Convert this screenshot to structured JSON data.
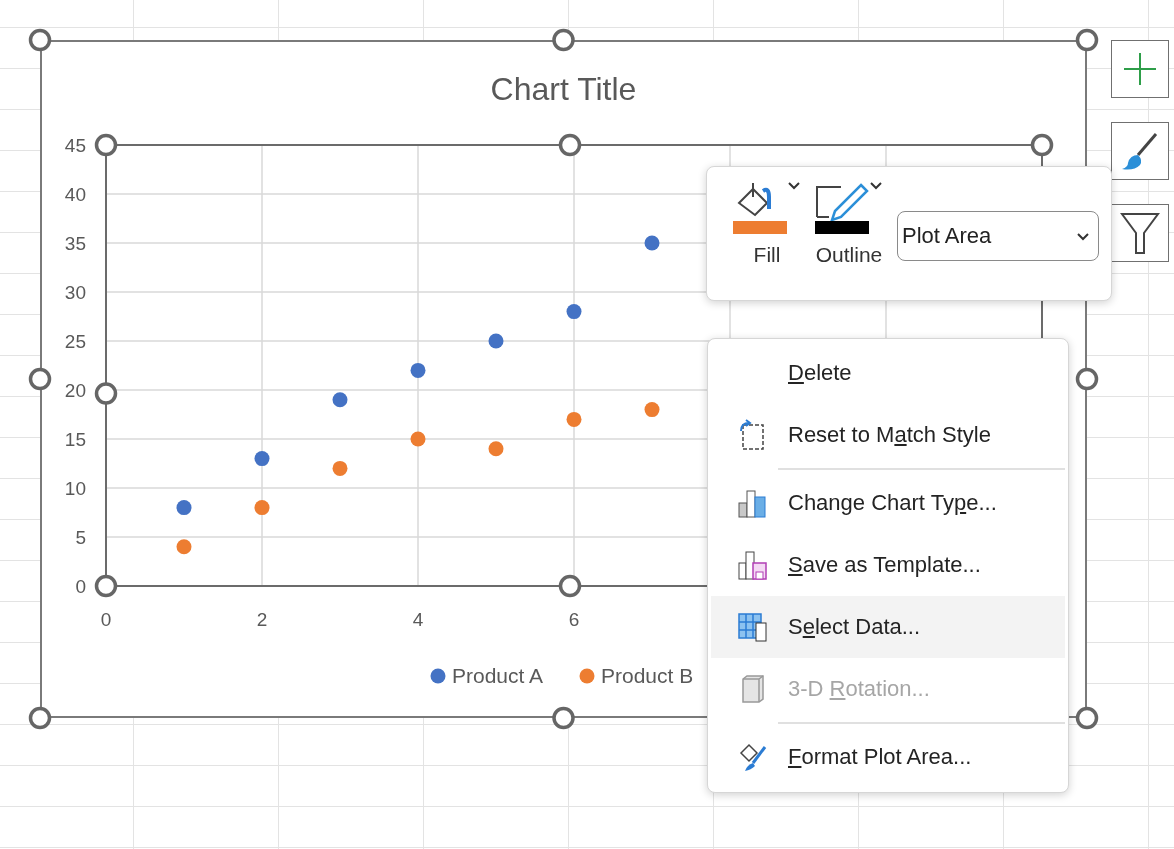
{
  "chart": {
    "selected": true,
    "plot_area_selected": true,
    "chart_data": {
      "type": "scatter",
      "title": "Chart Title",
      "grid": true,
      "legend": true,
      "x": [
        1,
        2,
        3,
        4,
        5,
        6,
        7
      ],
      "xlim": [
        0,
        12
      ],
      "ylim": [
        0,
        45
      ],
      "xticks": [
        0,
        2,
        4,
        6
      ],
      "yticks": [
        0,
        5,
        10,
        15,
        20,
        25,
        30,
        35,
        40,
        45
      ],
      "series": [
        {
          "name": "Product A",
          "color": "#4472c4",
          "values": [
            8,
            13,
            19,
            22,
            25,
            28,
            35
          ]
        },
        {
          "name": "Product B",
          "color": "#ed7d31",
          "values": [
            4,
            8,
            12,
            15,
            14,
            17,
            18
          ]
        }
      ]
    }
  },
  "toolbar": {
    "buttons": [
      {
        "kind": "fill",
        "label": "Fill",
        "color": "#ed7d31"
      },
      {
        "kind": "outline",
        "label": "Outline",
        "color": "#000000"
      }
    ],
    "dropdown": {
      "value": "Plot Area"
    }
  },
  "menu": {
    "items": [
      {
        "kind": "plain",
        "key": "D",
        "post": "elete",
        "selected": false,
        "disabled": false
      },
      {
        "kind": "reset",
        "pre": "Reset to M",
        "key": "a",
        "post": "tch Style",
        "selected": false,
        "disabled": false
      },
      {
        "kind": "separator"
      },
      {
        "kind": "charttype",
        "pre": "Change Chart Ty",
        "key": "p",
        "post": "e...",
        "selected": false,
        "disabled": false
      },
      {
        "kind": "template",
        "key": "S",
        "post": "ave as Template...",
        "selected": false,
        "disabled": false
      },
      {
        "kind": "data",
        "pre": "S",
        "key": "e",
        "post": "lect Data...",
        "selected": true,
        "disabled": false
      },
      {
        "kind": "rotation",
        "pre": "3-D ",
        "key": "R",
        "post": "otation...",
        "selected": false,
        "disabled": true
      },
      {
        "kind": "separator"
      },
      {
        "kind": "format",
        "key": "F",
        "post": "ormat Plot Area...",
        "selected": false,
        "disabled": false
      }
    ]
  }
}
